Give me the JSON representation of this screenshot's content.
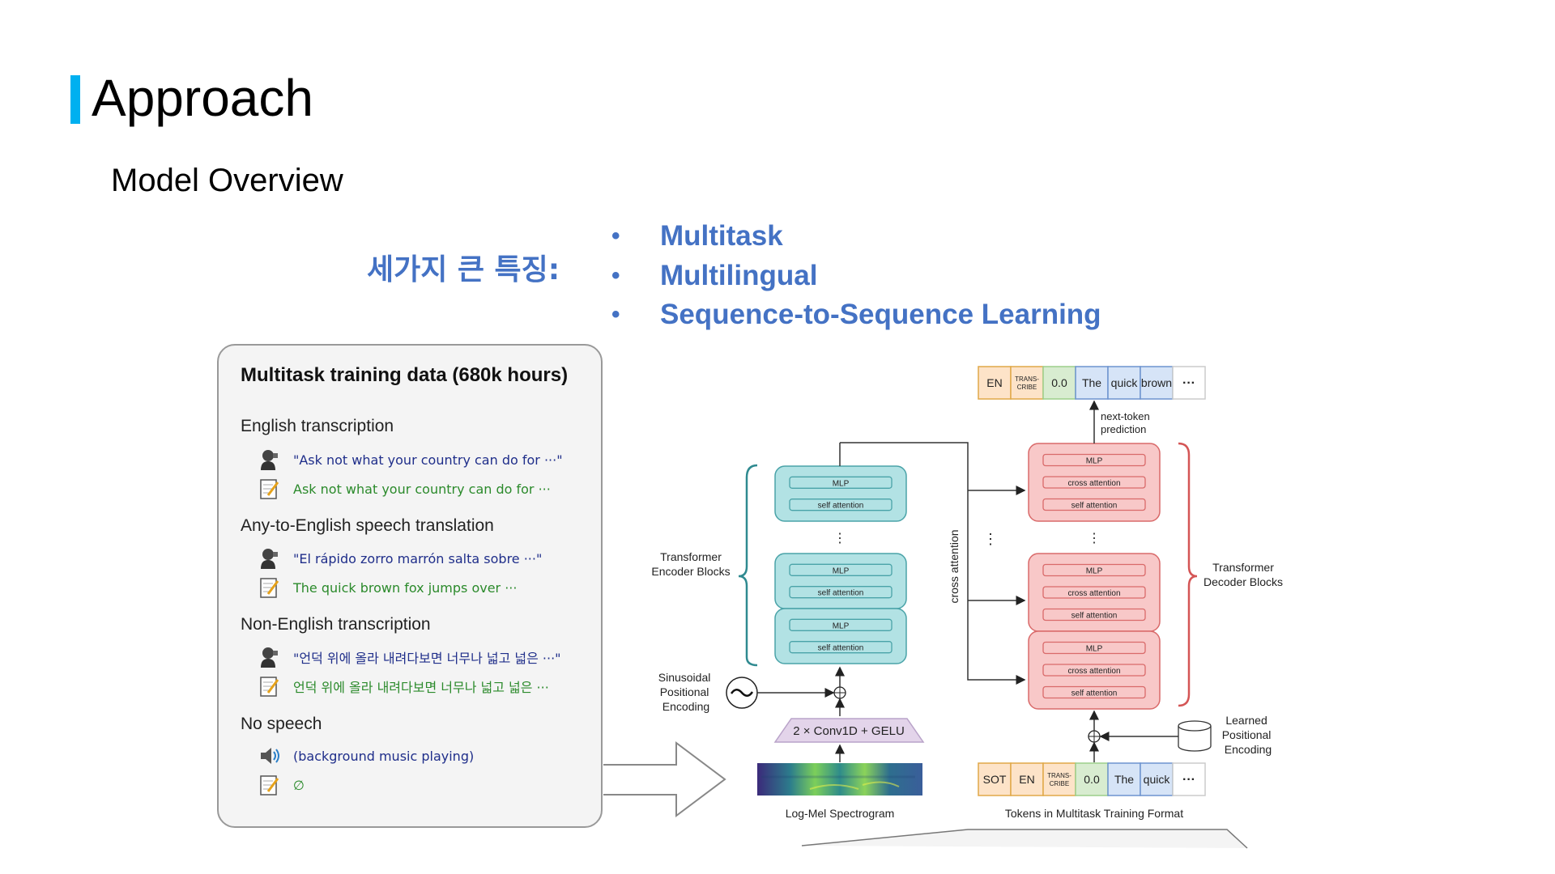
{
  "slide": {
    "title": "Approach",
    "subtitle": "Model Overview",
    "accent_color": "#00b0f0",
    "features_label": "세가지 큰 특징:",
    "features": [
      "Multitask",
      "Multilingual",
      "Sequence-to-Sequence Learning"
    ],
    "feature_color": "#4472c4"
  },
  "training_data": {
    "title": "Multitask training data (680k hours)",
    "categories": [
      {
        "name": "English transcription",
        "speech": "\"Ask not what your country can do for ···\"",
        "text": "Ask not what your country can do for ···"
      },
      {
        "name": "Any-to-English speech translation",
        "speech": "\"El rápido zorro marrón salta sobre ···\"",
        "text": "The quick brown fox jumps over ···"
      },
      {
        "name": "Non-English transcription",
        "speech": "\"언덕 위에 올라 내려다보면 너무나 넓고 넓은 ···\"",
        "text": "언덕 위에 올라 내려다보면 너무나 넓고 넓은 ···"
      },
      {
        "name": "No speech",
        "speech": "(background music playing)",
        "text": "∅"
      }
    ],
    "icons": {
      "speech": "speaker-person-icon",
      "text": "notepad-icon",
      "audio": "speaker-sound-icon"
    }
  },
  "diagram": {
    "encoder_label": "Transformer Encoder Blocks",
    "decoder_label": "Transformer Decoder Blocks",
    "mlp": "MLP",
    "self_attention": "self attention",
    "cross_attention": "cross attention",
    "cross_attention_vertical": "cross attention",
    "sinusoidal_label": [
      "Sinusoidal",
      "Positional",
      "Encoding"
    ],
    "learned_label": [
      "Learned",
      "Positional",
      "Encoding"
    ],
    "conv_label": "2 × Conv1D + GELU",
    "spectrogram_label": "Log-Mel Spectrogram",
    "tokens_label": "Tokens in Multitask Training Format",
    "next_token_label": [
      "next-token",
      "prediction"
    ],
    "output_tokens": [
      {
        "text": "EN",
        "type": "lang"
      },
      {
        "text": "TRANS-\nCRIBE",
        "type": "task"
      },
      {
        "text": "0.0",
        "type": "time"
      },
      {
        "text": "The",
        "type": "word"
      },
      {
        "text": "quick",
        "type": "word"
      },
      {
        "text": "brown",
        "type": "word"
      },
      {
        "text": "···",
        "type": "more"
      }
    ],
    "input_tokens": [
      {
        "text": "SOT",
        "type": "lang"
      },
      {
        "text": "EN",
        "type": "lang"
      },
      {
        "text": "TRANS-\nCRIBE",
        "type": "task"
      },
      {
        "text": "0.0",
        "type": "time"
      },
      {
        "text": "The",
        "type": "word"
      },
      {
        "text": "quick",
        "type": "word"
      },
      {
        "text": "···",
        "type": "more"
      }
    ],
    "colors": {
      "encoder_fill": "#b2e2e4",
      "encoder_stroke": "#4aa3a8",
      "decoder_fill": "#f8c8c8",
      "decoder_stroke": "#d96a6a",
      "conv_fill": "#e3d4ea",
      "token_orange": "#fde3c8",
      "token_green": "#d8ecd0",
      "token_blue": "#d6e4f7"
    }
  }
}
